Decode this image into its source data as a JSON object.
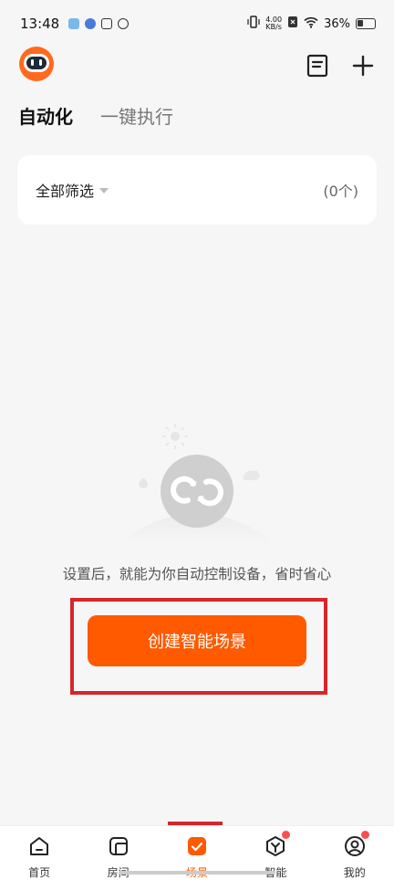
{
  "status_bar": {
    "time": "13:48",
    "net_speed_value": "4.00",
    "net_speed_unit": "KB/s",
    "battery": "36%"
  },
  "header": {
    "avatar_icon": "robot-avatar-icon",
    "doc_icon": "document-icon",
    "add_icon": "plus-icon"
  },
  "tabs": [
    {
      "label": "自动化",
      "active": true
    },
    {
      "label": "一键执行",
      "active": false
    }
  ],
  "filter": {
    "dropdown_label": "全部筛选",
    "count": "(0个)"
  },
  "empty_state": {
    "message": "设置后，就能为你自动控制设备，省时省心",
    "create_button": "创建智能场景"
  },
  "bottom_nav": [
    {
      "label": "首页",
      "icon": "home-icon"
    },
    {
      "label": "房间",
      "icon": "room-icon"
    },
    {
      "label": "场景",
      "icon": "scene-icon",
      "active": true
    },
    {
      "label": "智能",
      "icon": "smart-icon",
      "badge": true
    },
    {
      "label": "我的",
      "icon": "profile-icon",
      "badge": true
    }
  ],
  "colors": {
    "accent": "#ff5a00",
    "highlight": "#d6262b"
  }
}
